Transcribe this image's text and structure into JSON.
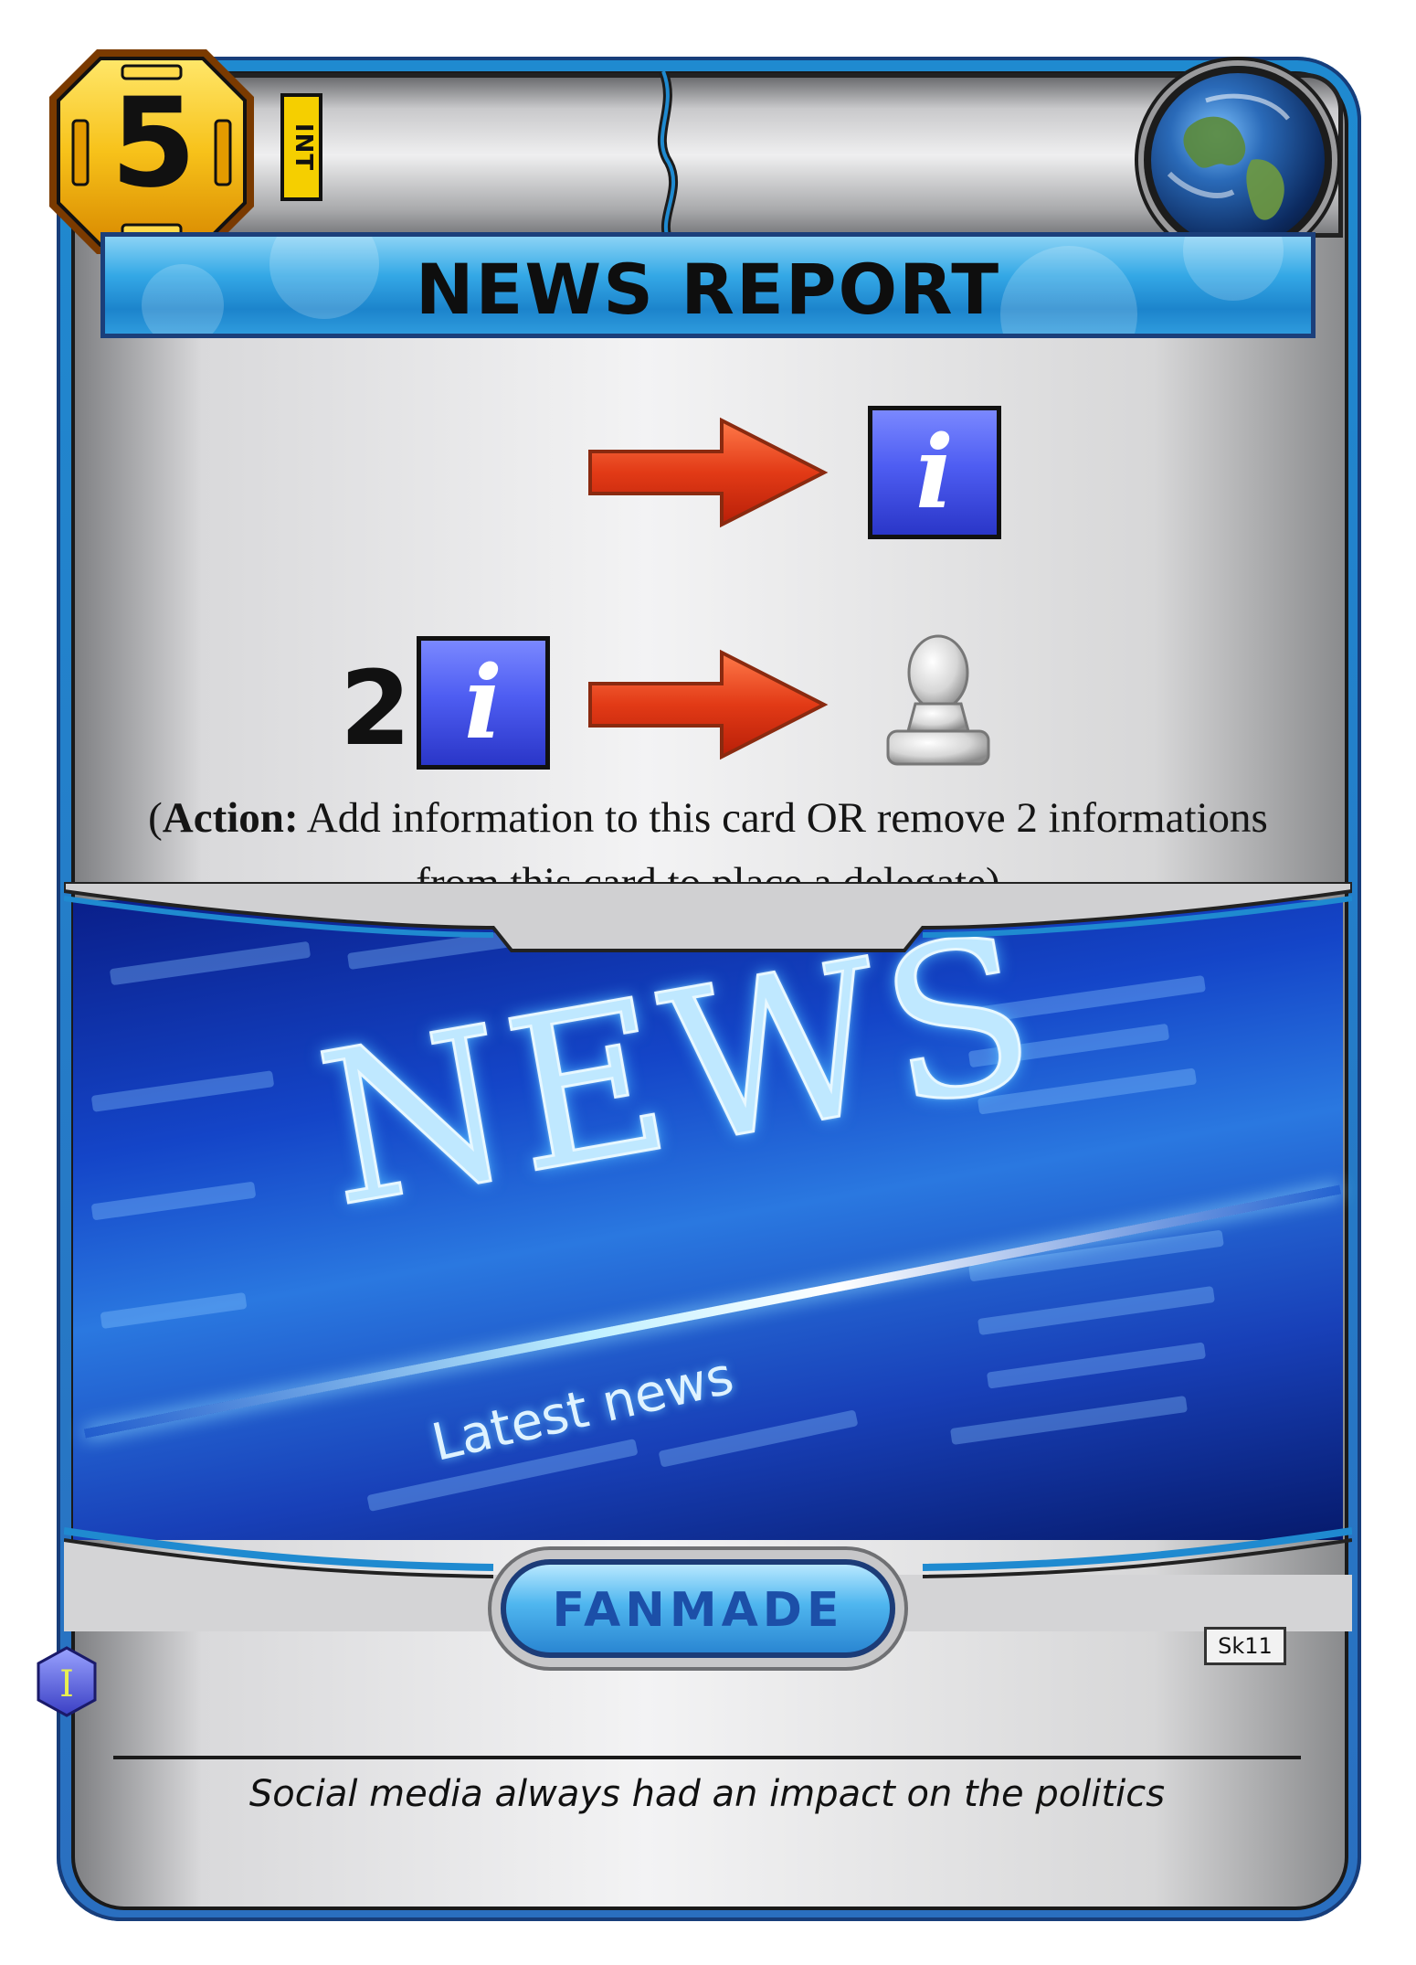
{
  "card": {
    "cost": "5",
    "class_tag": "INT",
    "title": "NEWS REPORT",
    "ability_row2_count": "2",
    "info_icon_glyph": "i",
    "rules": {
      "open_paren": "(",
      "action_label": "Action:",
      "text": " Add information to this card OR remove 2 informations from this card to place a delegate)"
    },
    "art": {
      "headline": "NEWS",
      "subheadline": "Latest news"
    },
    "fanmade_label": "FANMADE",
    "set_code": "Sk11",
    "rarity_letter": "I",
    "flavor_text": "Social media always had an impact on the politics"
  },
  "colors": {
    "frame_blue": "#1f8ad0",
    "title_blue": "#34a8e6",
    "cost_gold": "#f2b40a",
    "arrow_red": "#e23a16",
    "info_blue": "#4e5df2"
  },
  "icons": {
    "cost": "gold-octagon-icon",
    "world": "globe-icon",
    "arrow": "arrow-right-icon",
    "info": "info-icon",
    "delegate": "delegate-icon",
    "rarity": "hexagon-gem-icon"
  }
}
